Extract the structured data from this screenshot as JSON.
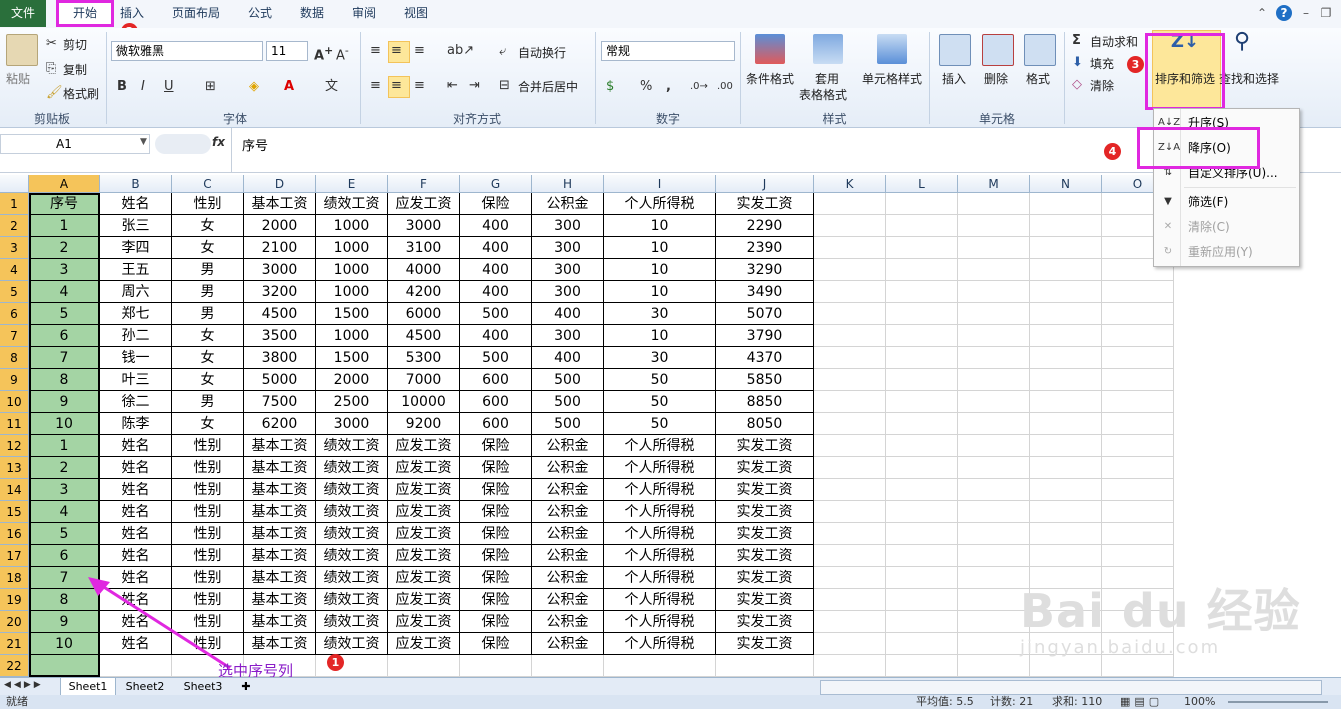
{
  "menu": {
    "file": "文件",
    "tabs": [
      "开始",
      "插入",
      "页面布局",
      "公式",
      "数据",
      "审阅",
      "视图"
    ]
  },
  "ribbon": {
    "clipboard": {
      "paste": "粘贴",
      "cut": "剪切",
      "copy": "复制",
      "painter": "格式刷",
      "group": "剪贴板"
    },
    "font": {
      "name": "微软雅黑",
      "size": "11",
      "bold": "B",
      "italic": "I",
      "underline": "U",
      "group": "字体"
    },
    "align": {
      "wrap": "自动换行",
      "merge": "合并后居中",
      "group": "对齐方式"
    },
    "number": {
      "format": "常规",
      "percent": "%",
      "comma": ",",
      "group": "数字"
    },
    "styles": {
      "conditional": "条件格式",
      "table1": "套用",
      "table2": "表格格式",
      "cellstyle": "单元格样式",
      "group": "样式"
    },
    "cells": {
      "insert": "插入",
      "delete": "删除",
      "format": "格式",
      "group": "单元格"
    },
    "editing": {
      "autosum": "自动求和",
      "fill": "填充",
      "clear": "清除",
      "sort": "排序和筛选",
      "find": "查找和选择",
      "sigma": "Σ"
    }
  },
  "formula_bar": {
    "name_box": "A1",
    "fx": "fx",
    "content": "序号"
  },
  "dropdown": {
    "items": [
      {
        "label": "升序(S)",
        "icon": "sort-ascending-icon",
        "glyph": "A↓Z"
      },
      {
        "label": "降序(O)",
        "icon": "sort-descending-icon",
        "glyph": "Z↓A"
      },
      {
        "label": "自定义排序(U)...",
        "icon": "custom-sort-icon",
        "glyph": "⇅"
      },
      {
        "label": "筛选(F)",
        "icon": "filter-icon",
        "glyph": "▼"
      },
      {
        "label": "清除(C)",
        "icon": "clear-filter-icon",
        "glyph": "✕"
      },
      {
        "label": "重新应用(Y)",
        "icon": "reapply-icon",
        "glyph": "↻"
      }
    ]
  },
  "badges": [
    "1",
    "2",
    "3",
    "4"
  ],
  "annotation": "选中序号列",
  "columns": [
    "A",
    "B",
    "C",
    "D",
    "E",
    "F",
    "G",
    "H",
    "I",
    "J",
    "K",
    "L",
    "M",
    "N",
    "O"
  ],
  "rows": [
    "1",
    "2",
    "3",
    "4",
    "5",
    "6",
    "7",
    "8",
    "9",
    "10",
    "11",
    "12",
    "13",
    "14",
    "15",
    "16",
    "17",
    "18",
    "19",
    "20",
    "21",
    "22"
  ],
  "table": [
    [
      "序号",
      "姓名",
      "性别",
      "基本工资",
      "绩效工资",
      "应发工资",
      "保险",
      "公积金",
      "个人所得税",
      "实发工资"
    ],
    [
      "1",
      "张三",
      "女",
      "2000",
      "1000",
      "3000",
      "400",
      "300",
      "10",
      "2290"
    ],
    [
      "2",
      "李四",
      "女",
      "2100",
      "1000",
      "3100",
      "400",
      "300",
      "10",
      "2390"
    ],
    [
      "3",
      "王五",
      "男",
      "3000",
      "1000",
      "4000",
      "400",
      "300",
      "10",
      "3290"
    ],
    [
      "4",
      "周六",
      "男",
      "3200",
      "1000",
      "4200",
      "400",
      "300",
      "10",
      "3490"
    ],
    [
      "5",
      "郑七",
      "男",
      "4500",
      "1500",
      "6000",
      "500",
      "400",
      "30",
      "5070"
    ],
    [
      "6",
      "孙二",
      "女",
      "3500",
      "1000",
      "4500",
      "400",
      "300",
      "10",
      "3790"
    ],
    [
      "7",
      "钱一",
      "女",
      "3800",
      "1500",
      "5300",
      "500",
      "400",
      "30",
      "4370"
    ],
    [
      "8",
      "叶三",
      "女",
      "5000",
      "2000",
      "7000",
      "600",
      "500",
      "50",
      "5850"
    ],
    [
      "9",
      "徐二",
      "男",
      "7500",
      "2500",
      "10000",
      "600",
      "500",
      "50",
      "8850"
    ],
    [
      "10",
      "陈李",
      "女",
      "6200",
      "3000",
      "9200",
      "600",
      "500",
      "50",
      "8050"
    ],
    [
      "1",
      "姓名",
      "性别",
      "基本工资",
      "绩效工资",
      "应发工资",
      "保险",
      "公积金",
      "个人所得税",
      "实发工资"
    ],
    [
      "2",
      "姓名",
      "性别",
      "基本工资",
      "绩效工资",
      "应发工资",
      "保险",
      "公积金",
      "个人所得税",
      "实发工资"
    ],
    [
      "3",
      "姓名",
      "性别",
      "基本工资",
      "绩效工资",
      "应发工资",
      "保险",
      "公积金",
      "个人所得税",
      "实发工资"
    ],
    [
      "4",
      "姓名",
      "性别",
      "基本工资",
      "绩效工资",
      "应发工资",
      "保险",
      "公积金",
      "个人所得税",
      "实发工资"
    ],
    [
      "5",
      "姓名",
      "性别",
      "基本工资",
      "绩效工资",
      "应发工资",
      "保险",
      "公积金",
      "个人所得税",
      "实发工资"
    ],
    [
      "6",
      "姓名",
      "性别",
      "基本工资",
      "绩效工资",
      "应发工资",
      "保险",
      "公积金",
      "个人所得税",
      "实发工资"
    ],
    [
      "7",
      "姓名",
      "性别",
      "基本工资",
      "绩效工资",
      "应发工资",
      "保险",
      "公积金",
      "个人所得税",
      "实发工资"
    ],
    [
      "8",
      "姓名",
      "性别",
      "基本工资",
      "绩效工资",
      "应发工资",
      "保险",
      "公积金",
      "个人所得税",
      "实发工资"
    ],
    [
      "9",
      "姓名",
      "性别",
      "基本工资",
      "绩效工资",
      "应发工资",
      "保险",
      "公积金",
      "个人所得税",
      "实发工资"
    ],
    [
      "10",
      "姓名",
      "性别",
      "基本工资",
      "绩效工资",
      "应发工资",
      "保险",
      "公积金",
      "个人所得税",
      "实发工资"
    ]
  ],
  "sheets": [
    "Sheet1",
    "Sheet2",
    "Sheet3"
  ],
  "status": {
    "ready": "就绪",
    "average": "平均值: 5.5",
    "count": "计数: 21",
    "sum": "求和: 110",
    "zoom": "100%"
  },
  "watermark": {
    "logo": "Bai du 经验",
    "url": "jingyan.baidu.com"
  },
  "colors": {
    "highlight": "#e028e0",
    "badge": "#e32626",
    "selected_col": "#a4d4a4",
    "file_tab": "#2a6f3b"
  }
}
